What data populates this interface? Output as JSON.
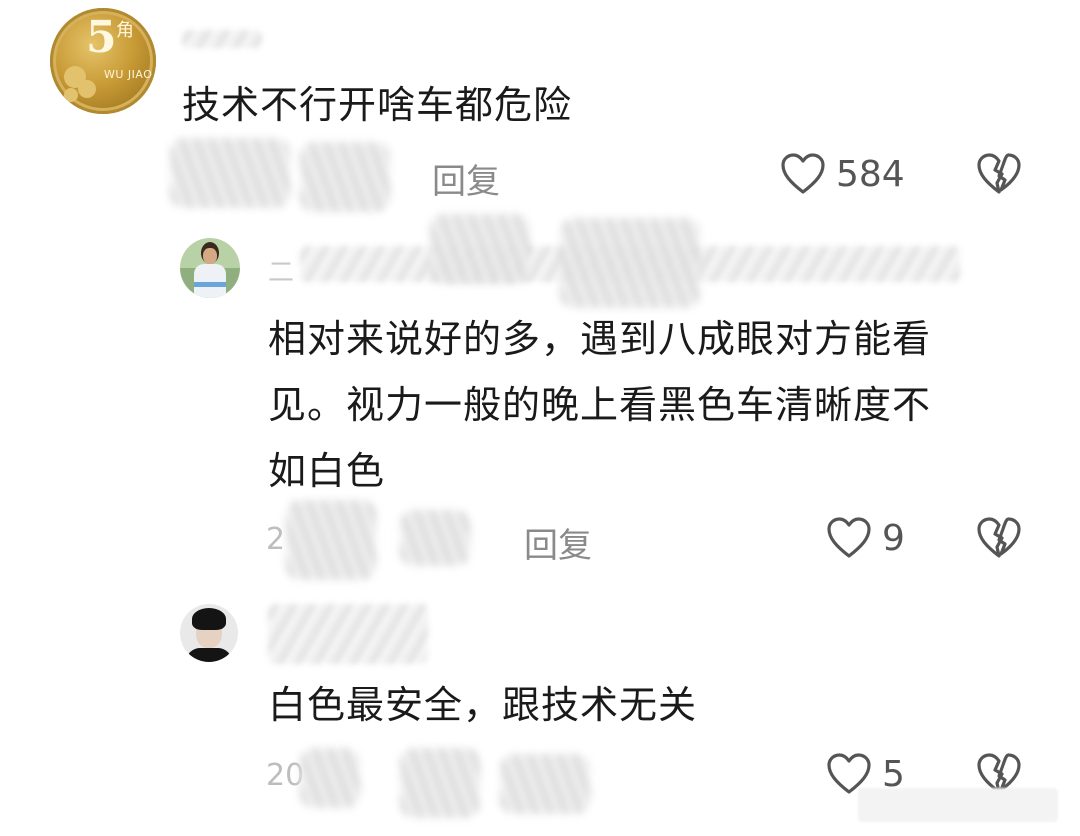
{
  "comments": [
    {
      "username_partial": "",
      "text": "技术不行开啥车都危险",
      "reply_label": "回复",
      "like_count": "584",
      "avatar_icon": "coin-avatar-icon"
    },
    {
      "username_partial": "二",
      "text_lines": [
        "相对来说好的多，遇到八成眼对方能看",
        "见。视力一般的晚上看黑色车清晰度不",
        "如白色"
      ],
      "date_partial": "2",
      "reply_label": "回复",
      "like_count": "9",
      "avatar_icon": "person-avatar-icon"
    },
    {
      "text": "白色最安全，跟技术无关",
      "date_partial": "20",
      "like_count": "5",
      "avatar_icon": "person-avatar-icon"
    }
  ],
  "icons": {
    "like": "heart-outline-icon",
    "dislike": "broken-heart-icon"
  },
  "colors": {
    "text": "#1a1a1a",
    "secondary": "#8a8a8a",
    "icon": "#555555"
  }
}
